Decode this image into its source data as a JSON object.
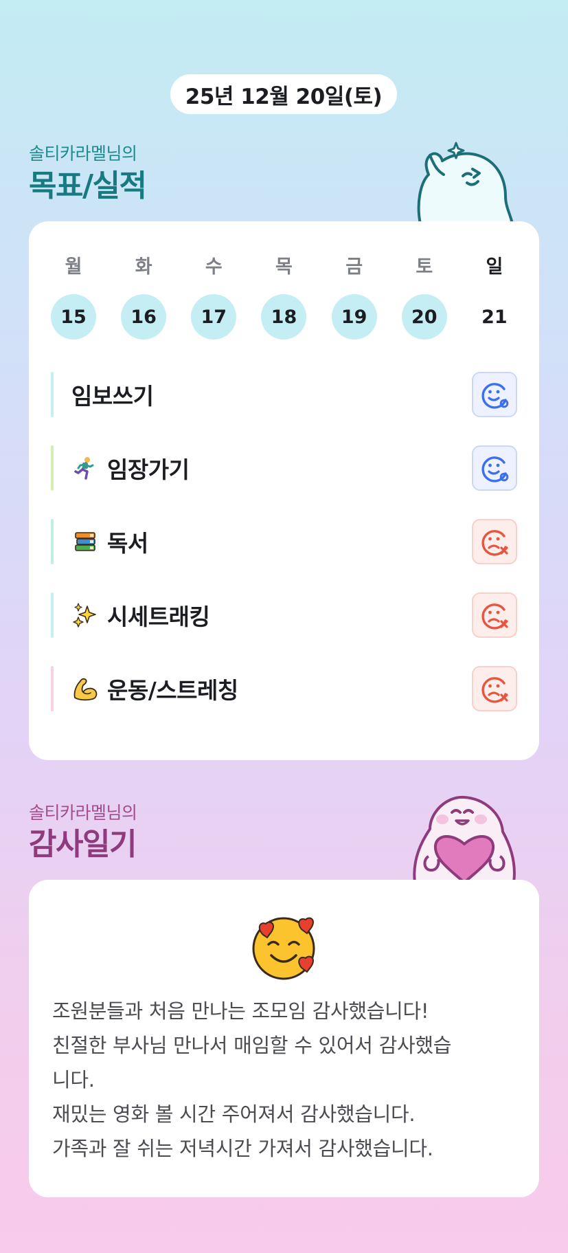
{
  "date_label": "25년 12월 20일(토)",
  "goals_section": {
    "subtitle": "솔티카라멜님의",
    "title": "목표/실적"
  },
  "week": {
    "days": [
      {
        "label": "월",
        "num": "15",
        "done": true
      },
      {
        "label": "화",
        "num": "16",
        "done": true
      },
      {
        "label": "수",
        "num": "17",
        "done": true
      },
      {
        "label": "목",
        "num": "18",
        "done": true
      },
      {
        "label": "금",
        "num": "19",
        "done": true
      },
      {
        "label": "토",
        "num": "20",
        "done": true
      },
      {
        "label": "일",
        "num": "21",
        "done": false
      }
    ]
  },
  "goals": [
    {
      "name": "임보쓰기",
      "emoji": "",
      "bar_color": "#c6eef4",
      "status": "success"
    },
    {
      "name": "임장가기",
      "emoji": "runner-icon",
      "bar_color": "#d4efb6",
      "status": "success"
    },
    {
      "name": "독서",
      "emoji": "books-icon",
      "bar_color": "#bff0e6",
      "status": "fail"
    },
    {
      "name": "시세트래킹",
      "emoji": "sparkles-icon",
      "bar_color": "#c6eef4",
      "status": "fail"
    },
    {
      "name": "운동/스트레칭",
      "emoji": "flexed-biceps-icon",
      "bar_color": "#f9d0e8",
      "status": "fail"
    }
  ],
  "gratitude_section": {
    "subtitle": "솔티카라멜님의",
    "title": "감사일기"
  },
  "gratitude": {
    "emoji": "smiling-face-with-hearts-icon",
    "lines": [
      "조원분들과 처음 만나는 조모임 감사했습니다!",
      "친절한 부사님 만나서 매임할 수 있어서 감사했습",
      "니다.",
      "재밌는 영화 볼 시간 주어져서 감사했습니다.",
      "가족과 잘 쉬는 저녁시간 가져서 감사했습니다."
    ]
  },
  "colors": {
    "success": "#3b6ff0",
    "fail": "#e8553f",
    "goal_title": "#177a80",
    "gratitude_title": "#8f3a7c"
  }
}
